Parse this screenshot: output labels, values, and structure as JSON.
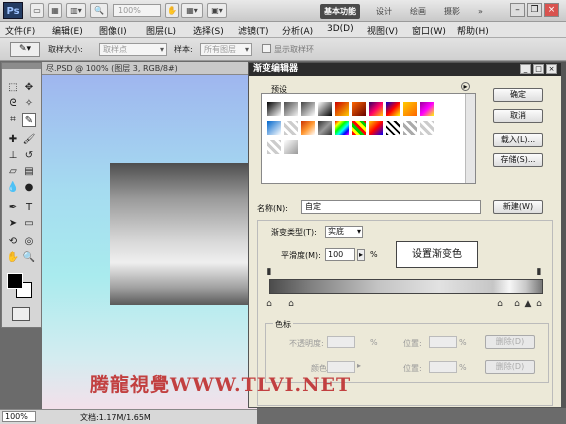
{
  "app": {
    "logo": "Ps",
    "zoom": "100%",
    "workspaces": [
      "基本功能",
      "设计",
      "绘画",
      "摄影"
    ]
  },
  "menus": [
    "文件(F)",
    "编辑(E)",
    "图像(I)",
    "图层(L)",
    "选择(S)",
    "滤镜(T)",
    "分析(A)",
    "3D(D)",
    "视图(V)",
    "窗口(W)",
    "帮助(H)"
  ],
  "options": {
    "sample_size_label": "取样大小:",
    "sample_size_value": "取样点",
    "sample_label": "样本:",
    "sample_value": "所有图层",
    "show_ring_label": "显示取样环"
  },
  "document": {
    "tab_title": "尽.PSD @ 100% (图层 3, RGB/8#)",
    "zoom": "100%",
    "doc_info": "文档:1.17M/1.65M"
  },
  "dialog": {
    "title": "渐变编辑器",
    "presets_label": "预设",
    "ok": "确定",
    "cancel": "取消",
    "load": "载入(L)...",
    "save": "存储(S)...",
    "name_label": "名称(N):",
    "name_value": "自定",
    "new": "新建(W)",
    "gradient_type_label": "渐变类型(T):",
    "gradient_type_value": "实底",
    "smoothness_label": "平滑度(M):",
    "smoothness_value": "100",
    "percent": "%",
    "stops_label": "色标",
    "opacity_label": "不透明度:",
    "location_label": "位置:",
    "delete_label": "删除(D)",
    "color_label": "颜色:"
  },
  "tip": "设置渐变色",
  "watermark": "腾龍視覺WWW.TLVI.NET"
}
